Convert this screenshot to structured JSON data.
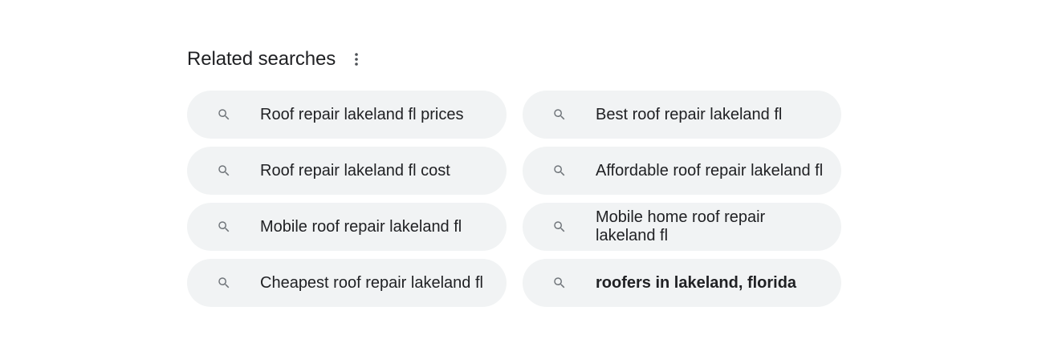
{
  "related": {
    "title": "Related searches",
    "more_icon": "more-vert-icon",
    "search_icon": "search-icon",
    "items": [
      {
        "label": "Roof repair lakeland fl prices",
        "bold": false
      },
      {
        "label": "Best roof repair lakeland fl",
        "bold": false
      },
      {
        "label": "Roof repair lakeland fl cost",
        "bold": false
      },
      {
        "label": "Affordable roof repair lakeland fl",
        "bold": false
      },
      {
        "label": "Mobile roof repair lakeland fl",
        "bold": false
      },
      {
        "label": "Mobile home roof repair lakeland fl",
        "bold": false
      },
      {
        "label": "Cheapest roof repair lakeland fl",
        "bold": false
      },
      {
        "label": "roofers in lakeland, florida",
        "bold": true
      }
    ]
  },
  "colors": {
    "chip_background": "#f1f3f4",
    "text": "#202124",
    "icon": "#70757a"
  }
}
